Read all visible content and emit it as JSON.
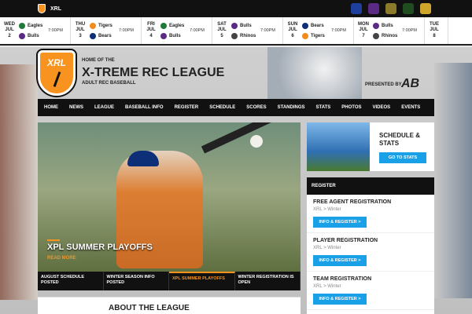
{
  "topbar": {
    "logo_label": "XRL",
    "team_colors": [
      "#1f3f9c",
      "#5b2a86",
      "#8b7a2a",
      "#1f4d1f",
      "#d0a52b"
    ]
  },
  "scores": [
    {
      "date": "WED\nJUL\n2",
      "team1": "Eagles",
      "team2": "Bulls",
      "time": "7:00PM",
      "c1": "#1f7a3a",
      "c2": "#5b2a86"
    },
    {
      "date": "THU\nJUL\n3",
      "team1": "Tigers",
      "team2": "Bears",
      "time": "7:00PM",
      "c1": "#f28c1e",
      "c2": "#0c2f77"
    },
    {
      "date": "FRI\nJUL\n4",
      "team1": "Eagles",
      "team2": "Bulls",
      "time": "7:00PM",
      "c1": "#1f7a3a",
      "c2": "#5b2a86"
    },
    {
      "date": "SAT\nJUL\n5",
      "team1": "Bulls",
      "team2": "Rhinos",
      "time": "7:00PM",
      "c1": "#5b2a86",
      "c2": "#444444"
    },
    {
      "date": "SUN\nJUL\n6",
      "team1": "Bears",
      "team2": "Tigers",
      "time": "7:00PM",
      "c1": "#0c2f77",
      "c2": "#f28c1e"
    },
    {
      "date": "MON\nJUL\n7",
      "team1": "Bulls",
      "team2": "Rhinos",
      "time": "7:00PM",
      "c1": "#5b2a86",
      "c2": "#444444"
    }
  ],
  "scores_partial": {
    "date": "TUE\nJUL\n8"
  },
  "header": {
    "logo_text": "XRL",
    "home_of": "HOME OF THE",
    "league_name": "X-TREME REC LEAGUE",
    "subtitle": "ADULT REC BASEBALL",
    "presented": "PRESENTED BY",
    "sponsor": "AB"
  },
  "nav": [
    "HOME",
    "NEWS",
    "LEAGUE",
    "BASEBALL INFO",
    "REGISTER",
    "SCHEDULE",
    "SCORES",
    "STANDINGS",
    "STATS",
    "PHOTOS",
    "VIDEOS",
    "EVENTS"
  ],
  "feature": {
    "title": "XPL SUMMER PLAYOFFS",
    "read_more": "READ MORE"
  },
  "tabs": [
    {
      "label": "AUGUST SCHEDULE POSTED",
      "active": false
    },
    {
      "label": "WINTER SEASON INFO POSTED",
      "active": false
    },
    {
      "label": "XPL SUMMER PLAYOFFS",
      "active": true
    },
    {
      "label": "WINTER REGISTRATION IS OPEN",
      "active": false
    }
  ],
  "about": {
    "title": "ABOUT THE LEAGUE"
  },
  "stats_box": {
    "title": "SCHEDULE & STATS",
    "button": "GO TO STATS"
  },
  "register": {
    "header": "REGISTER",
    "items": [
      {
        "name": "FREE AGENT REGISTRATION",
        "meta": "XRL > Winter",
        "button": "INFO & REGISTER >"
      },
      {
        "name": "PLAYER REGISTRATION",
        "meta": "XRL > Winter",
        "button": "INFO & REGISTER >"
      },
      {
        "name": "TEAM REGISTRATION",
        "meta": "XRL > Winter",
        "button": "INFO & REGISTER >"
      }
    ]
  }
}
